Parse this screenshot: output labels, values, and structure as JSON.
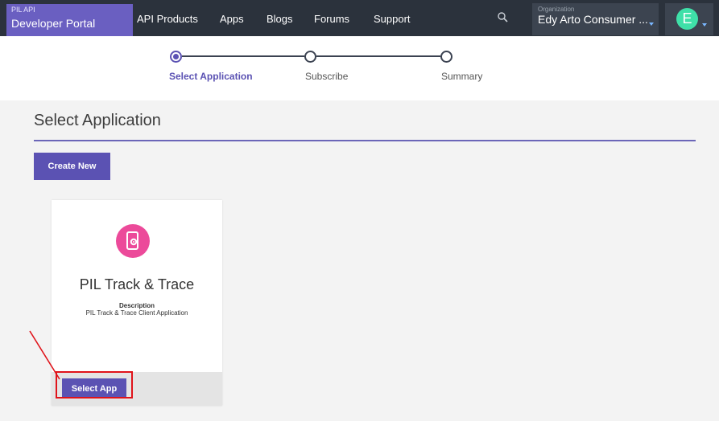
{
  "header": {
    "brand_small": "PIL API",
    "brand_big": "Developer Portal",
    "nav": [
      "API Products",
      "Apps",
      "Blogs",
      "Forums",
      "Support"
    ],
    "org_label": "Organization",
    "org_value": "Edy Arto Consumer ...",
    "avatar_letter": "E"
  },
  "stepper": {
    "steps": [
      "Select Application",
      "Subscribe",
      "Summary"
    ],
    "active_index": 0
  },
  "main": {
    "title": "Select Application",
    "create_label": "Create New"
  },
  "app_card": {
    "title": "PIL Track & Trace",
    "description_label": "Description",
    "description": "PIL Track & Trace Client Application",
    "select_label": "Select App",
    "icon": "mobile-app-icon"
  },
  "colors": {
    "accent": "#5b52b3",
    "brand": "#6a5fc1",
    "topbar": "#2b323c",
    "app_icon": "#ec4a9a",
    "annotation": "#e0131a"
  }
}
